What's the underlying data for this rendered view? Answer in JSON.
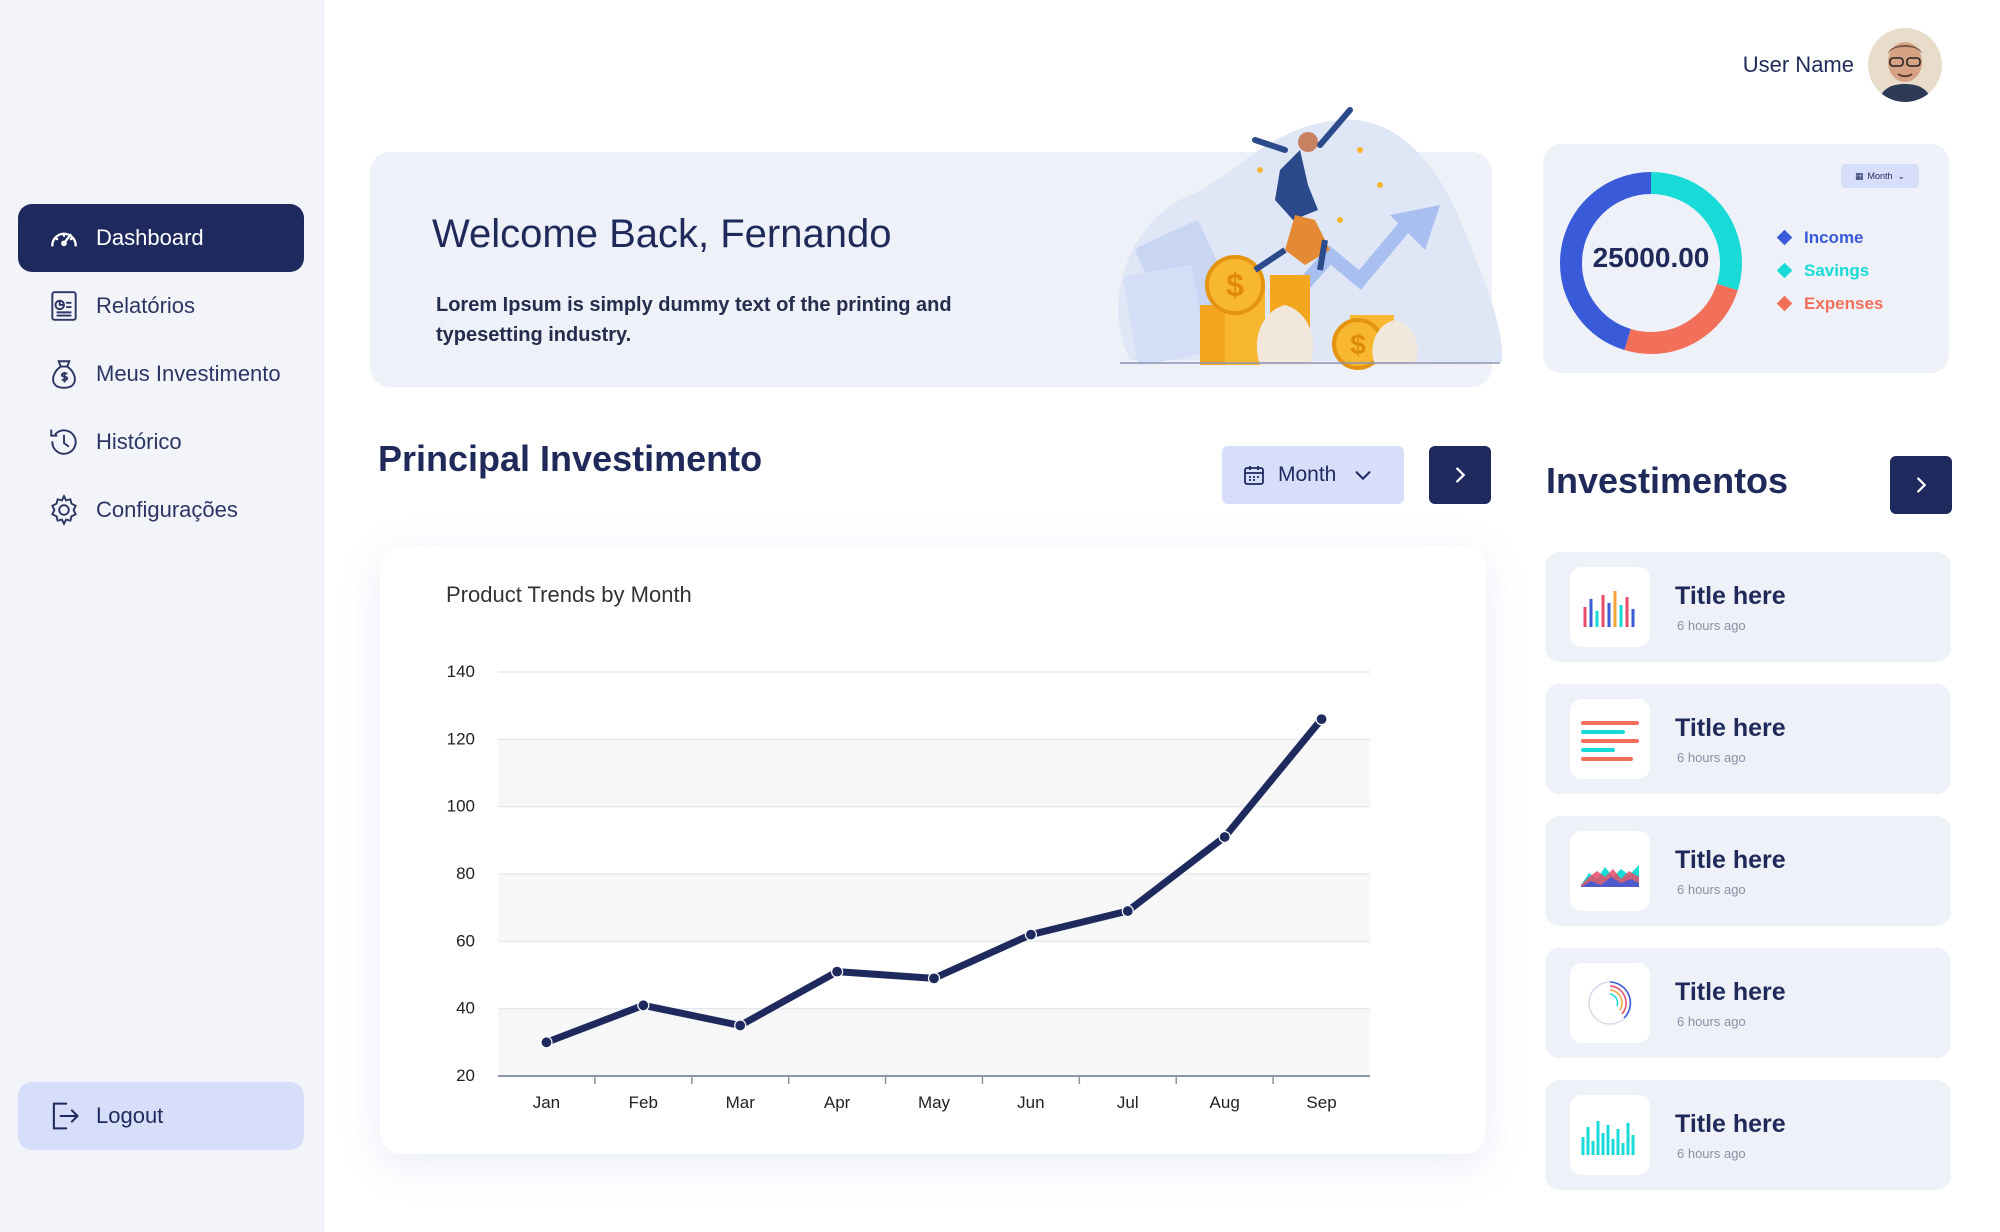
{
  "user": {
    "name": "User Name"
  },
  "sidebar": {
    "items": [
      {
        "label": "Dashboard",
        "icon": "speedometer-icon",
        "active": true
      },
      {
        "label": "Relatórios",
        "icon": "report-icon",
        "active": false
      },
      {
        "label": "Meus Investimento",
        "icon": "money-bag-icon",
        "active": false
      },
      {
        "label": "Histórico",
        "icon": "history-icon",
        "active": false
      },
      {
        "label": "Configurações",
        "icon": "gear-icon",
        "active": false
      }
    ],
    "logout_label": "Logout"
  },
  "welcome": {
    "title": "Welcome Back, Fernando",
    "text": "Lorem Ipsum is simply dummy text of the printing and typesetting industry."
  },
  "summary": {
    "total": "25000.00",
    "filter_label": "Month",
    "legend": [
      {
        "label": "Income",
        "color": "#3a5bd9"
      },
      {
        "label": "Savings",
        "color": "#18dbd8"
      },
      {
        "label": "Expenses",
        "color": "#f2705a"
      }
    ]
  },
  "principal": {
    "title": "Principal Investimento",
    "filter_label": "Month"
  },
  "investimentos": {
    "title": "Investimentos",
    "items": [
      {
        "title": "Title here",
        "time": "6 hours ago",
        "icon": "bar-chart-thumb-icon"
      },
      {
        "title": "Title here",
        "time": "6 hours ago",
        "icon": "horizontal-bars-thumb-icon"
      },
      {
        "title": "Title here",
        "time": "6 hours ago",
        "icon": "area-chart-thumb-icon"
      },
      {
        "title": "Title here",
        "time": "6 hours ago",
        "icon": "radial-chart-thumb-icon"
      },
      {
        "title": "Title here",
        "time": "6 hours ago",
        "icon": "histogram-thumb-icon"
      }
    ]
  },
  "chart_data": {
    "type": "line",
    "title": "Product Trends by Month",
    "categories": [
      "Jan",
      "Feb",
      "Mar",
      "Apr",
      "May",
      "Jun",
      "Jul",
      "Aug",
      "Sep"
    ],
    "series": [
      {
        "values": [
          30,
          41,
          35,
          51,
          49,
          62,
          69,
          91,
          126
        ],
        "color": "#1e2a5e"
      }
    ],
    "yticks": [
      20,
      40,
      60,
      80,
      100,
      120,
      140
    ],
    "ylim": [
      20,
      140
    ],
    "grid": true
  }
}
